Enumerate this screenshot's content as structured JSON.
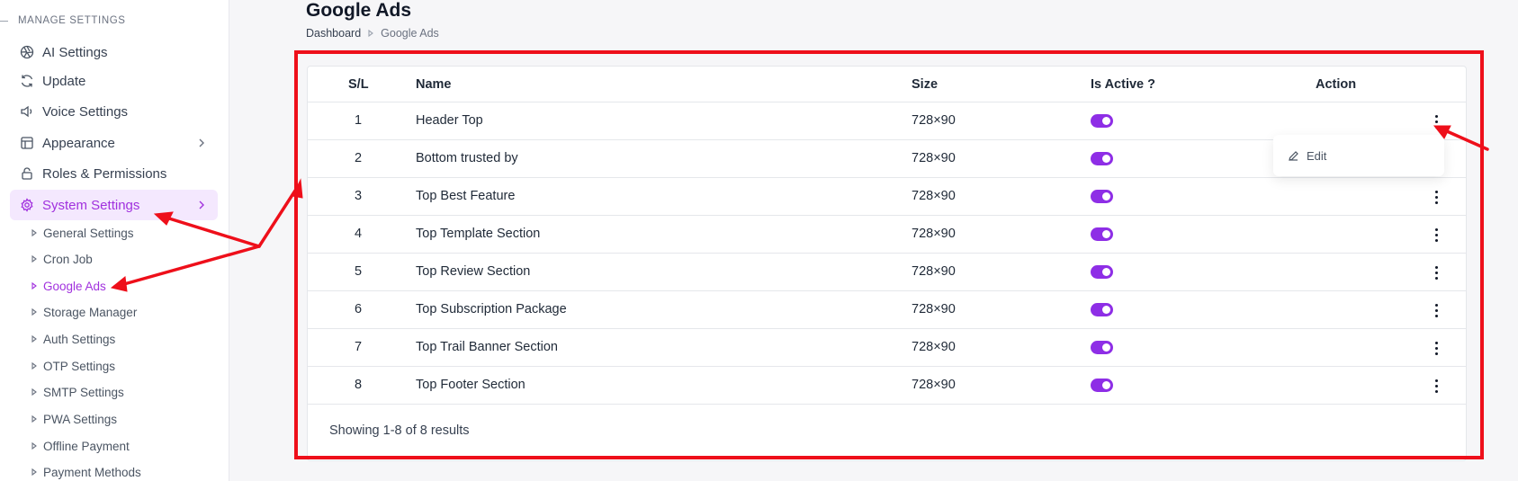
{
  "sidebar": {
    "section_label": "MANAGE SETTINGS",
    "items": [
      {
        "label": "AI Settings",
        "icon": "aperture-icon"
      },
      {
        "label": "Update",
        "icon": "refresh-icon"
      },
      {
        "label": "Voice Settings",
        "icon": "speaker-icon"
      },
      {
        "label": "Appearance",
        "icon": "layout-icon"
      },
      {
        "label": "Roles & Permissions",
        "icon": "lock-icon"
      },
      {
        "label": "System Settings",
        "icon": "gear-icon"
      }
    ],
    "sub_items": [
      "General Settings",
      "Cron Job",
      "Google Ads",
      "Storage Manager",
      "Auth Settings",
      "OTP Settings",
      "SMTP Settings",
      "PWA Settings",
      "Offline Payment",
      "Payment Methods"
    ]
  },
  "page": {
    "title": "Google Ads",
    "breadcrumb": [
      "Dashboard",
      "Google Ads"
    ]
  },
  "table": {
    "headers": [
      "S/L",
      "Name",
      "Size",
      "Is Active ?",
      "Action"
    ],
    "rows": [
      {
        "sl": "1",
        "name": "Header Top",
        "size": "728×90",
        "active": true
      },
      {
        "sl": "2",
        "name": "Bottom trusted by",
        "size": "728×90",
        "active": true
      },
      {
        "sl": "3",
        "name": "Top Best Feature",
        "size": "728×90",
        "active": true
      },
      {
        "sl": "4",
        "name": "Top Template Section",
        "size": "728×90",
        "active": true
      },
      {
        "sl": "5",
        "name": "Top Review Section",
        "size": "728×90",
        "active": true
      },
      {
        "sl": "6",
        "name": "Top Subscription Package",
        "size": "728×90",
        "active": true
      },
      {
        "sl": "7",
        "name": "Top Trail Banner Section",
        "size": "728×90",
        "active": true
      },
      {
        "sl": "8",
        "name": "Top Footer Section",
        "size": "728×90",
        "active": true
      }
    ],
    "footer": "Showing 1-8 of 8 results"
  },
  "dropdown": {
    "edit_label": "Edit"
  },
  "colors": {
    "accent": "#a131de",
    "toggle": "#8e2ee6",
    "annotation": "#ee0f1a"
  }
}
